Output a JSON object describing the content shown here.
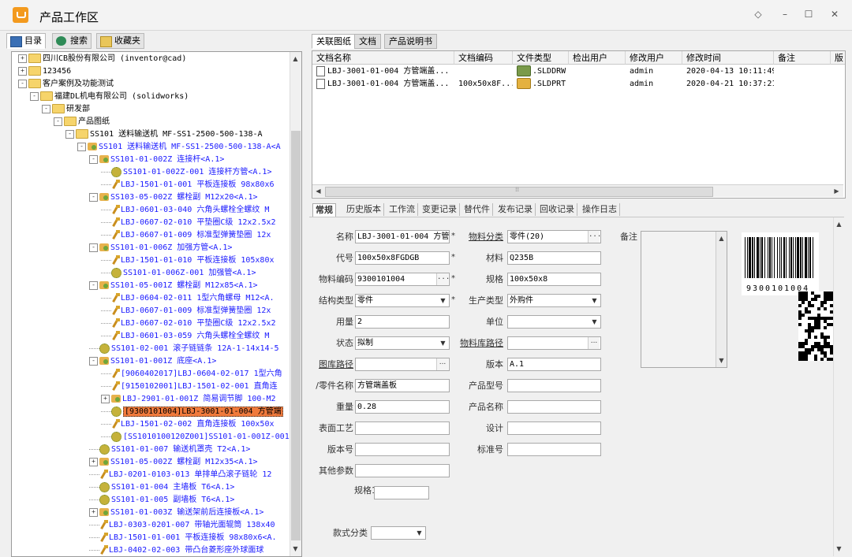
{
  "app": {
    "title": "产品工作区"
  },
  "window_controls": {
    "restore": "◇",
    "minimize": "–",
    "maximize": "☐",
    "close": "✕"
  },
  "left_tabs": [
    {
      "label": "目录",
      "icon": "catalog-icon"
    },
    {
      "label": "搜索",
      "icon": "search-icon"
    },
    {
      "label": "收藏夹",
      "icon": "favorites-icon"
    }
  ],
  "tree": [
    {
      "t": "四川CB股份有限公司 (inventor@cad)",
      "icon": "folder",
      "toggle": "+",
      "d": 1
    },
    {
      "t": "123456",
      "icon": "folder",
      "toggle": "+",
      "d": 1
    },
    {
      "t": "客户案例及功能测试",
      "icon": "folder",
      "toggle": "-",
      "d": 1
    },
    {
      "t": "福建DL机电有限公司 (solidworks)",
      "icon": "folder",
      "toggle": "-",
      "d": 2
    },
    {
      "t": "研发部",
      "icon": "folder",
      "toggle": "-",
      "d": 3
    },
    {
      "t": "产品图纸",
      "icon": "folder",
      "toggle": "-",
      "d": 4
    },
    {
      "t": "SS101 送料输送机 MF-SS1-2500-500-138-A",
      "icon": "folder",
      "toggle": "-",
      "d": 5
    },
    {
      "t": "SS101 送料输送机 MF-SS1-2500-500-138-A<A",
      "icon": "asm",
      "toggle": "-",
      "d": 6,
      "blue": true
    },
    {
      "t": "SS101-01-002Z 连接杆<A.1>",
      "icon": "asm",
      "toggle": "-",
      "d": 7,
      "blue": true
    },
    {
      "t": "SS101-01-002Z-001 连接杆方管<A.1>",
      "icon": "gear",
      "toggle": "",
      "d": 8,
      "blue": true
    },
    {
      "t": "LBJ-1501-01-001 平板连接板 98x80x6",
      "icon": "part",
      "toggle": "",
      "d": 8,
      "blue": true
    },
    {
      "t": "SS103-05-002Z 螺栓副 M12x20<A.1>",
      "icon": "asm",
      "toggle": "-",
      "d": 7,
      "blue": true
    },
    {
      "t": "LBJ-0601-03-040 六角头螺栓全螺纹 M",
      "icon": "part",
      "toggle": "",
      "d": 8,
      "blue": true
    },
    {
      "t": "LBJ-0607-02-010 平垫圈C级 12x2.5x2",
      "icon": "part",
      "toggle": "",
      "d": 8,
      "blue": true
    },
    {
      "t": "LBJ-0607-01-009 标准型弹簧垫圈 12x",
      "icon": "part",
      "toggle": "",
      "d": 8,
      "blue": true
    },
    {
      "t": "SS101-01-006Z 加强方管<A.1>",
      "icon": "asm",
      "toggle": "-",
      "d": 7,
      "blue": true
    },
    {
      "t": "LBJ-1501-01-010 平板连接板 105x80x",
      "icon": "part",
      "toggle": "",
      "d": 8,
      "blue": true
    },
    {
      "t": "SS101-01-006Z-001 加强管<A.1>",
      "icon": "gear",
      "toggle": "",
      "d": 8,
      "blue": true
    },
    {
      "t": "SS101-05-001Z 螺栓副 M12x85<A.1>",
      "icon": "asm",
      "toggle": "-",
      "d": 7,
      "blue": true
    },
    {
      "t": "LBJ-0604-02-011 1型六角螺母 M12<A.",
      "icon": "part",
      "toggle": "",
      "d": 8,
      "blue": true
    },
    {
      "t": "LBJ-0607-01-009 标准型弹簧垫圈 12x",
      "icon": "part",
      "toggle": "",
      "d": 8,
      "blue": true
    },
    {
      "t": "LBJ-0607-02-010 平垫圈C级 12x2.5x2",
      "icon": "part",
      "toggle": "",
      "d": 8,
      "blue": true
    },
    {
      "t": "LBJ-0601-03-059 六角头螺栓全螺纹 M",
      "icon": "part",
      "toggle": "",
      "d": 8,
      "blue": true
    },
    {
      "t": "SS101-02-001 滚子链链条 12A-1-14x14-5",
      "icon": "gear",
      "toggle": "",
      "d": 7,
      "blue": true
    },
    {
      "t": "SS101-01-001Z 底座<A.1>",
      "icon": "asm",
      "toggle": "-",
      "d": 7,
      "blue": true
    },
    {
      "t": "[9060402017]LBJ-0604-02-017 1型六角",
      "icon": "part",
      "toggle": "",
      "d": 8,
      "blue": true
    },
    {
      "t": "[9150102001]LBJ-1501-02-001 直角连",
      "icon": "part",
      "toggle": "",
      "d": 8,
      "blue": true
    },
    {
      "t": "LBJ-2901-01-001Z 简易调节脚 100-M2",
      "icon": "asm",
      "toggle": "+",
      "d": 8,
      "blue": true
    },
    {
      "t": "[9300101004]LBJ-3001-01-004 方管端",
      "icon": "gear",
      "toggle": "",
      "d": 8,
      "hl": true
    },
    {
      "t": "LBJ-1501-02-002 直角连接板 100x50x",
      "icon": "part",
      "toggle": "",
      "d": 8,
      "blue": true
    },
    {
      "t": "[SS1010100120Z001]SS101-01-001Z-001",
      "icon": "gear",
      "toggle": "",
      "d": 8,
      "blue": true
    },
    {
      "t": "SS101-01-007 输送机罩壳 T2<A.1>",
      "icon": "gear",
      "toggle": "",
      "d": 7,
      "blue": true
    },
    {
      "t": "SS101-05-002Z 螺栓副 M12x35<A.1>",
      "icon": "asm",
      "toggle": "+",
      "d": 7,
      "blue": true
    },
    {
      "t": "LBJ-0201-0103-013 单排单凸滚子链轮 12",
      "icon": "part",
      "toggle": "",
      "d": 7,
      "blue": true
    },
    {
      "t": "SS101-01-004 主墙板 T6<A.1>",
      "icon": "gear",
      "toggle": "",
      "d": 7,
      "blue": true
    },
    {
      "t": "SS101-01-005 副墙板 T6<A.1>",
      "icon": "gear",
      "toggle": "",
      "d": 7,
      "blue": true
    },
    {
      "t": "SS101-01-003Z 输送架前后连接板<A.1>",
      "icon": "asm",
      "toggle": "+",
      "d": 7,
      "blue": true
    },
    {
      "t": "LBJ-0303-0201-007 带轴光面辊筒 138x40",
      "icon": "part",
      "toggle": "",
      "d": 7,
      "blue": true
    },
    {
      "t": "LBJ-1501-01-001 平板连接板 98x80x6<A.",
      "icon": "part",
      "toggle": "",
      "d": 7,
      "blue": true
    },
    {
      "t": "LBJ-0402-02-003 带凸台菱形座外球面球",
      "icon": "part",
      "toggle": "",
      "d": 7,
      "blue": true
    }
  ],
  "right_tabs": [
    "关联图纸",
    "文档",
    "产品说明书"
  ],
  "grid": {
    "headers": [
      "文档名称",
      "文档编码",
      "文件类型",
      "检出用户",
      "修改用户",
      "修改时间",
      "备注",
      "版"
    ],
    "rows": [
      {
        "name": "LBJ-3001-01-004 方管端盖...",
        "code": "",
        "type": ".SLDDRW",
        "checkout": "",
        "modifier": "admin",
        "time": "2020-04-13 10:11:49",
        "remark": ""
      },
      {
        "name": "LBJ-3001-01-004 方管端盖...",
        "code": "100x50x8F...",
        "type": ".SLDPRT",
        "checkout": "",
        "modifier": "admin",
        "time": "2020-04-21 10:37:21",
        "remark": ""
      }
    ],
    "hscroll_mark": "⁞⁞"
  },
  "detail_tabs": [
    "常规",
    "历史版本",
    "工作流",
    "变更记录",
    "替代件",
    "发布记录",
    "回收记录",
    "操作日志"
  ],
  "form": {
    "name": {
      "label": "名称",
      "value": "LBJ-3001-01-004 方管端"
    },
    "category": {
      "label": "物料分类",
      "value": "零件(20)"
    },
    "remark_label": "备注",
    "code": {
      "label": "代号",
      "value": "100x50x8FGDGB"
    },
    "material": {
      "label": "材料",
      "value": "Q235B"
    },
    "mat_code": {
      "label": "物料编码",
      "value": "9300101004"
    },
    "spec": {
      "label": "规格",
      "value": "100x50x8"
    },
    "struct_type": {
      "label": "结构类型",
      "value": "零件"
    },
    "prod_type": {
      "label": "生产类型",
      "value": "外购件"
    },
    "qty": {
      "label": "用量",
      "value": "2"
    },
    "unit": {
      "label": "单位",
      "value": ""
    },
    "status": {
      "label": "状态",
      "value": "拟制"
    },
    "lib_path": {
      "label": "物料库路径",
      "value": ""
    },
    "draw_path": {
      "label": "图库路径",
      "value": ""
    },
    "version": {
      "label": "版本",
      "value": "A.1"
    },
    "part_name": {
      "label": "/零件名称",
      "value": "方管端盖板"
    },
    "prod_model": {
      "label": "产品型号",
      "value": ""
    },
    "weight": {
      "label": "重量",
      "value": "0.28"
    },
    "prod_name": {
      "label": "产品名称",
      "value": ""
    },
    "surface": {
      "label": "表面工艺",
      "value": ""
    },
    "design": {
      "label": "设计",
      "value": ""
    },
    "ver_no": {
      "label": "版本号",
      "value": ""
    },
    "std_no": {
      "label": "标准号",
      "value": ""
    },
    "other": {
      "label": "其他参数",
      "value": ""
    },
    "spec1": {
      "label": "规格1",
      "value": ""
    },
    "style": {
      "label": "款式分类",
      "value": ""
    },
    "barcode_text": "9300101004"
  }
}
